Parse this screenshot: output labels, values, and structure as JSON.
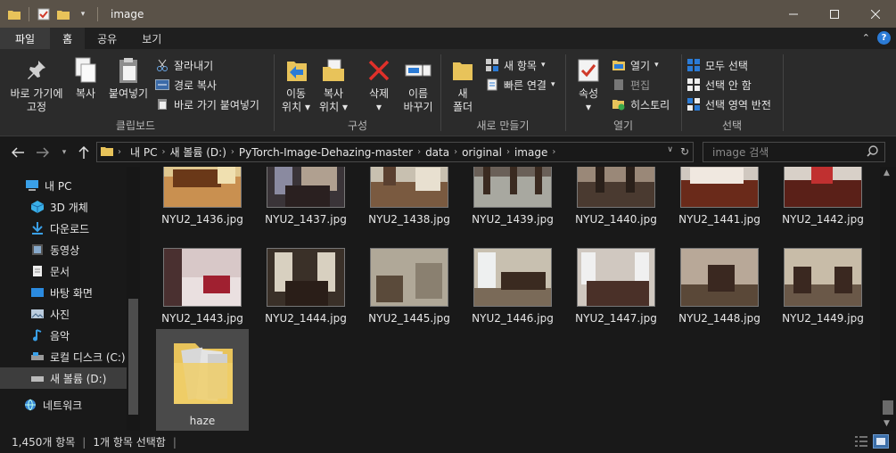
{
  "window": {
    "title": "image"
  },
  "ribbon_tabs": [
    "파일",
    "홈",
    "공유",
    "보기"
  ],
  "ribbon": {
    "clipboard": {
      "pin_label_1": "바로 가기에",
      "pin_label_2": "고정",
      "copy": "복사",
      "paste": "붙여넣기",
      "cut": "잘라내기",
      "copy_path": "경로 복사",
      "paste_shortcut": "바로 가기 붙여넣기",
      "group": "클립보드"
    },
    "organize": {
      "move_1": "이동",
      "move_2": "위치",
      "copy_1": "복사",
      "copy_2": "위치",
      "delete": "삭제",
      "rename_1": "이름",
      "rename_2": "바꾸기",
      "group": "구성"
    },
    "new": {
      "folder_1": "새",
      "folder_2": "폴더",
      "new_item": "새 항목",
      "easy_access": "빠른 연결",
      "group": "새로 만들기"
    },
    "open": {
      "properties": "속성",
      "open": "열기",
      "edit": "편집",
      "history": "히스토리",
      "group": "열기"
    },
    "select": {
      "select_all": "모두 선택",
      "select_none": "선택 안 함",
      "invert": "선택 영역 반전",
      "group": "선택"
    }
  },
  "address": {
    "crumbs": [
      "내 PC",
      "새 볼륨 (D:)",
      "PyTorch-Image-Dehazing-master",
      "data",
      "original",
      "image"
    ],
    "search_placeholder": "image 검색"
  },
  "nav": {
    "items": [
      {
        "label": "내 PC",
        "icon": "pc-icon"
      },
      {
        "label": "3D 개체",
        "icon": "3d-objects-icon"
      },
      {
        "label": "다운로드",
        "icon": "download-icon"
      },
      {
        "label": "동영상",
        "icon": "video-icon"
      },
      {
        "label": "문서",
        "icon": "document-icon"
      },
      {
        "label": "바탕 화면",
        "icon": "desktop-icon"
      },
      {
        "label": "사진",
        "icon": "pictures-icon"
      },
      {
        "label": "음악",
        "icon": "music-icon"
      },
      {
        "label": "로컬 디스크 (C:)",
        "icon": "drive-icon"
      },
      {
        "label": "새 볼륨 (D:)",
        "icon": "drive-icon"
      },
      {
        "label": "네트워크",
        "icon": "network-icon"
      }
    ]
  },
  "files": {
    "row1": [
      "NYU2_1436.jpg",
      "NYU2_1437.jpg",
      "NYU2_1438.jpg",
      "NYU2_1439.jpg",
      "NYU2_1440.jpg",
      "NYU2_1441.jpg",
      "NYU2_1442.jpg"
    ],
    "row2": [
      "NYU2_1443.jpg",
      "NYU2_1444.jpg",
      "NYU2_1445.jpg",
      "NYU2_1446.jpg",
      "NYU2_1447.jpg",
      "NYU2_1448.jpg",
      "NYU2_1449.jpg"
    ],
    "folder": "haze"
  },
  "status": {
    "count": "1,450개 항목",
    "selected": "1개 항목 선택함"
  },
  "colors": {
    "accent": "#2b7bd6",
    "folder": "#e8c35a",
    "delete": "#e0302a"
  }
}
